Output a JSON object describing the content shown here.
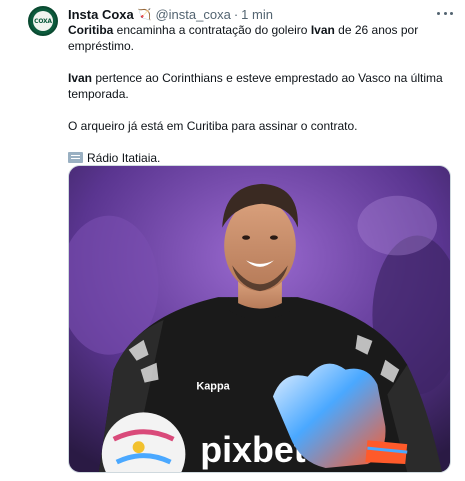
{
  "tweet": {
    "author_name": "Insta Coxa",
    "author_flag": "🏹",
    "handle": "@insta_coxa",
    "separator": "·",
    "time": "1 min",
    "avatar_text": "INSTA COXA",
    "paragraphs": [
      {
        "bold": "Coritiba",
        "text1": " encaminha a contratação do goleiro ",
        "bold2": "Ivan",
        "text2": " de 26 anos por empréstimo."
      },
      {
        "bold": "Ivan",
        "text1": " pertence ao Corinthians e esteve emprestado ao Vasco na última temporada."
      },
      {
        "text1": "O arqueiro já está em Curitiba para assinar o contrato."
      },
      {
        "text1": "Rádio Itatiaia."
      }
    ],
    "media": {
      "shirt_brand": "Kappa",
      "sponsor": "pixbet"
    }
  },
  "colors": {
    "text": "#0f1419",
    "meta": "#536471",
    "avatar_green": "#0c5a3c",
    "media_purple": "#6b3fa0",
    "jersey": "#1a1a1a",
    "glove_blue": "#4aa8ff"
  },
  "icons": {
    "more": "more-dots-icon",
    "news": "newspaper-icon",
    "flag": "bow-and-arrow-icon"
  }
}
